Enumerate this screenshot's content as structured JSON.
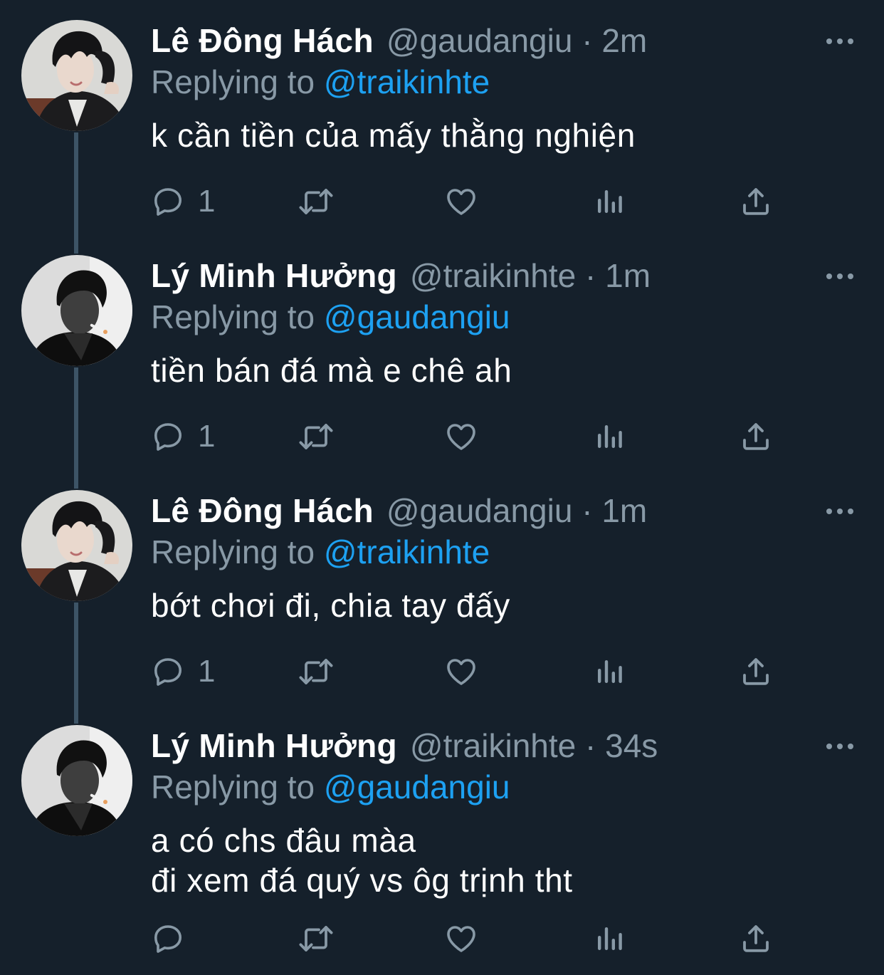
{
  "colors": {
    "background": "#15202b",
    "text_primary": "#ffffff",
    "text_secondary": "#8899a6",
    "link": "#1da1f2",
    "thread_line": "#3d5466"
  },
  "actions": {
    "reply_icon": "reply-icon",
    "retweet_icon": "retweet-icon",
    "like_icon": "heart-icon",
    "analytics_icon": "analytics-icon",
    "share_icon": "share-icon",
    "more_icon": "more-icon"
  },
  "tweets": [
    {
      "name": "Lê Đông Hách",
      "handle": "@gaudangiu",
      "time": "2m",
      "replying_label": "Replying to",
      "replying_to": "@traikinhte",
      "text_lines": [
        "k cần tiền của mấy thằng nghiện"
      ],
      "reply_count": "1",
      "avatar": "avatar-gaudangiu"
    },
    {
      "name": "Lý Minh Hưởng",
      "handle": "@traikinhte",
      "time": "1m",
      "replying_label": "Replying to",
      "replying_to": "@gaudangiu",
      "text_lines": [
        "tiền bán đá mà e chê ah"
      ],
      "reply_count": "1",
      "avatar": "avatar-traikinhte"
    },
    {
      "name": "Lê Đông Hách",
      "handle": "@gaudangiu",
      "time": "1m",
      "replying_label": "Replying to",
      "replying_to": "@traikinhte",
      "text_lines": [
        "bớt chơi đi, chia tay đấy"
      ],
      "reply_count": "1",
      "avatar": "avatar-gaudangiu"
    },
    {
      "name": "Lý Minh Hưởng",
      "handle": "@traikinhte",
      "time": "34s",
      "replying_label": "Replying to",
      "replying_to": "@gaudangiu",
      "text_lines": [
        "a có chs đâu màa",
        "đi xem đá quý vs ôg trịnh tht"
      ],
      "reply_count": "",
      "avatar": "avatar-traikinhte"
    }
  ]
}
